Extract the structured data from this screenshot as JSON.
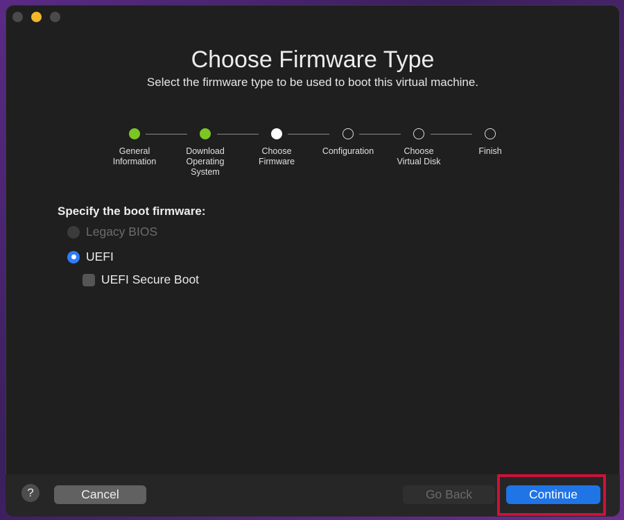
{
  "window": {
    "title": "Choose Firmware Type",
    "subtitle": "Select the firmware type to be used to boot this virtual machine."
  },
  "steps": [
    {
      "label": "General\nInformation",
      "state": "done"
    },
    {
      "label": "Download\nOperating\nSystem",
      "state": "done"
    },
    {
      "label": "Choose\nFirmware",
      "state": "current"
    },
    {
      "label": "Configuration",
      "state": "pending"
    },
    {
      "label": "Choose\nVirtual Disk",
      "state": "pending"
    },
    {
      "label": "Finish",
      "state": "pending"
    }
  ],
  "firmware": {
    "section_label": "Specify the boot firmware:",
    "legacy_bios_label": "Legacy BIOS",
    "legacy_bios_enabled": false,
    "uefi_label": "UEFI",
    "uefi_selected": true,
    "secure_boot_label": "UEFI Secure Boot",
    "secure_boot_checked": false
  },
  "footer": {
    "help_label": "?",
    "cancel_label": "Cancel",
    "go_back_label": "Go Back",
    "go_back_enabled": false,
    "continue_label": "Continue"
  },
  "colors": {
    "window_bg": "#1f1f1f",
    "step_done": "#7cc624",
    "accent_blue": "#1f74e6",
    "highlight_box": "#d0103a"
  }
}
